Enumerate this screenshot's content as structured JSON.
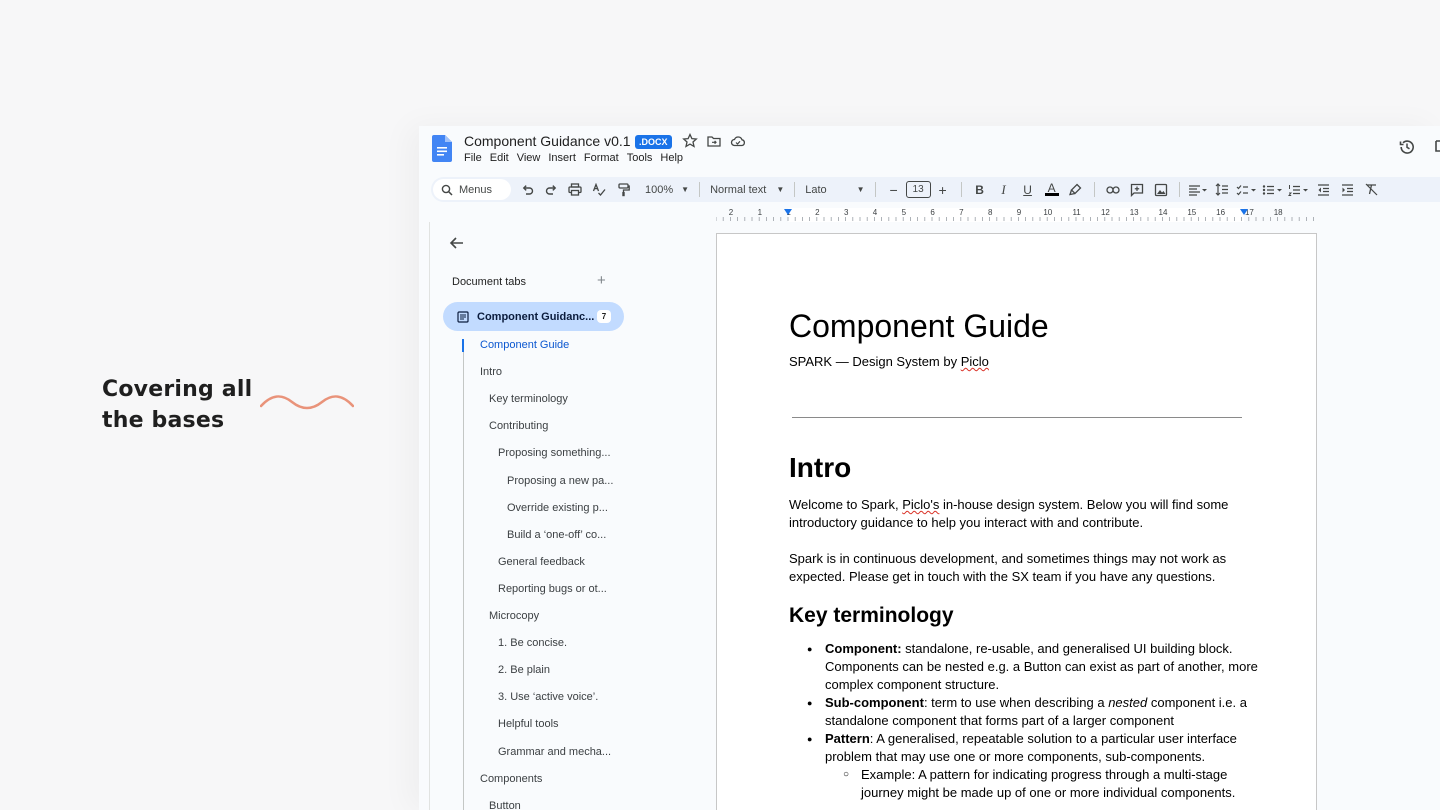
{
  "tagline": {
    "line1": "Covering all",
    "line2": "the bases"
  },
  "header": {
    "doc_title": "Component Guidance v0.1",
    "badge": ".DOCX",
    "menu": [
      "File",
      "Edit",
      "View",
      "Insert",
      "Format",
      "Tools",
      "Help"
    ]
  },
  "toolbar": {
    "search_label": "Menus",
    "zoom": "100%",
    "style": "Normal text",
    "font": "Lato",
    "font_size": "13",
    "minus": "−",
    "plus": "+",
    "bold": "B",
    "italic": "I",
    "underline": "U",
    "text_color_letter": "A"
  },
  "sidebar": {
    "heading": "Document tabs",
    "add": "+",
    "active_tab": {
      "label": "Component Guidanc...",
      "count": "7"
    },
    "outline": [
      {
        "label": "Component Guide",
        "indent": 0,
        "active": true
      },
      {
        "label": "Intro",
        "indent": 0
      },
      {
        "label": "Key terminology",
        "indent": 1
      },
      {
        "label": "Contributing",
        "indent": 1
      },
      {
        "label": "Proposing something...",
        "indent": 2
      },
      {
        "label": "Proposing a new pa...",
        "indent": 3
      },
      {
        "label": "Override existing p...",
        "indent": 3
      },
      {
        "label": "Build a ‘one-off’ co...",
        "indent": 3
      },
      {
        "label": "General feedback",
        "indent": 2
      },
      {
        "label": "Reporting bugs or ot...",
        "indent": 2
      },
      {
        "label": "Microcopy",
        "indent": 1
      },
      {
        "label": "1. Be concise.",
        "indent": 2
      },
      {
        "label": "2. Be plain",
        "indent": 2
      },
      {
        "label": "3. Use ‘active voice’.",
        "indent": 2
      },
      {
        "label": "Helpful tools",
        "indent": 2
      },
      {
        "label": "Grammar and mecha...",
        "indent": 2
      },
      {
        "label": "Components",
        "indent": 0
      },
      {
        "label": "Button",
        "indent": 1
      }
    ]
  },
  "ruler": {
    "labels": [
      "2",
      "1",
      "1",
      "2",
      "3",
      "4",
      "5",
      "6",
      "7",
      "8",
      "9",
      "10",
      "11",
      "12",
      "13",
      "14",
      "15",
      "16",
      "17",
      "18"
    ]
  },
  "document": {
    "title": "Component Guide",
    "subtitle_prefix": "SPARK — Design System by ",
    "subtitle_link": "Piclo",
    "intro_heading": "Intro",
    "intro_p1_a": "Welcome to Spark, ",
    "intro_p1_b": "Piclo's",
    "intro_p1_c": " in-house design system. Below you will find some introductory guidance to help you interact with and contribute.",
    "intro_p2": "Spark is in continuous development, and sometimes things may not work as expected. Please get in touch with the SX team if you have any questions.",
    "key_heading": "Key terminology",
    "terms": [
      {
        "term": "Component:",
        "text": " standalone, re-usable, and generalised UI building block. Components can be nested e.g. a Button can exist as part of another, more complex component structure."
      },
      {
        "term": "Sub-component",
        "text_a": ": term to use when describing a ",
        "em": "nested",
        "text_b": " component i.e. a standalone component that forms part of a larger component"
      },
      {
        "term": "Pattern",
        "text": ": A generalised, repeatable solution to a particular user interface problem that may use one or more components, sub-components."
      },
      {
        "sub": "Example: A pattern for indicating progress through a multi-stage journey might be made up of one or more individual components."
      }
    ]
  }
}
